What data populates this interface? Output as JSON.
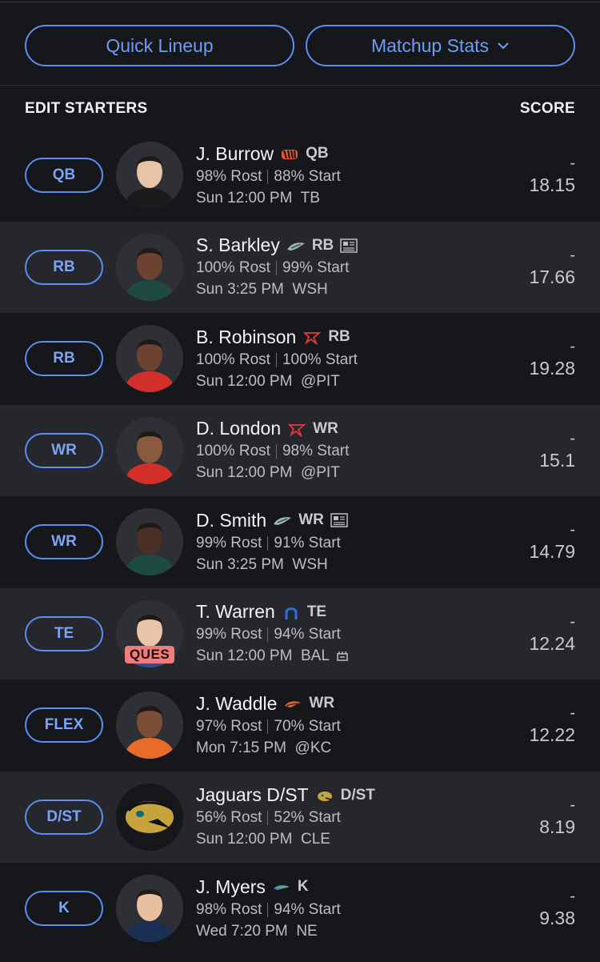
{
  "actions": {
    "quick_lineup": "Quick Lineup",
    "matchup_stats": "Matchup Stats"
  },
  "header": {
    "left": "EDIT STARTERS",
    "right": "SCORE"
  },
  "colors": {
    "accent": "#5a8ef0",
    "row_alt": "#26272c",
    "background": "#16171b",
    "ques_badge": "#f07c7c"
  },
  "players": [
    {
      "slot": "QB",
      "name": "J. Burrow",
      "team_icon": "bengals-icon",
      "pos": "QB",
      "rost": "98% Rost",
      "start": "88% Start",
      "game": "Sun 12:00 PM  TB",
      "dash": "-",
      "score": "18.15"
    },
    {
      "slot": "RB",
      "name": "S. Barkley",
      "team_icon": "eagles-icon",
      "pos": "RB",
      "news": true,
      "rost": "100% Rost",
      "start": "99% Start",
      "game": "Sun 3:25 PM  WSH",
      "dash": "-",
      "score": "17.66"
    },
    {
      "slot": "RB",
      "name": "B. Robinson",
      "team_icon": "falcons-icon",
      "pos": "RB",
      "rost": "100% Rost",
      "start": "100% Start",
      "game": "Sun 12:00 PM  @PIT",
      "dash": "-",
      "score": "19.28"
    },
    {
      "slot": "WR",
      "name": "D. London",
      "team_icon": "falcons-icon",
      "pos": "WR",
      "rost": "100% Rost",
      "start": "98% Start",
      "game": "Sun 12:00 PM  @PIT",
      "dash": "-",
      "score": "15.1"
    },
    {
      "slot": "WR",
      "name": "D. Smith",
      "team_icon": "eagles-icon",
      "pos": "WR",
      "news": true,
      "rost": "99% Rost",
      "start": "91% Start",
      "game": "Sun 3:25 PM  WSH",
      "dash": "-",
      "score": "14.79"
    },
    {
      "slot": "TE",
      "name": "T. Warren",
      "team_icon": "colts-icon",
      "pos": "TE",
      "status": "QUES",
      "rost": "99% Rost",
      "start": "94% Start",
      "game": "Sun 12:00 PM  BAL",
      "game_icon": "stadium-icon",
      "dash": "-",
      "score": "12.24"
    },
    {
      "slot": "FLEX",
      "name": "J. Waddle",
      "team_icon": "broncos-icon",
      "pos": "WR",
      "rost": "97% Rost",
      "start": "70% Start",
      "game": "Mon 7:15 PM  @KC",
      "dash": "-",
      "score": "12.22"
    },
    {
      "slot": "D/ST",
      "name": "Jaguars D/ST",
      "team_icon": "jaguars-icon",
      "pos": "D/ST",
      "rost": "56% Rost",
      "start": "52% Start",
      "game": "Sun 12:00 PM  CLE",
      "dash": "-",
      "score": "8.19"
    },
    {
      "slot": "K",
      "name": "J. Myers",
      "team_icon": "seahawks-icon",
      "pos": "K",
      "rost": "98% Rost",
      "start": "94% Start",
      "game": "Wed 7:20 PM  NE",
      "dash": "-",
      "score": "9.38"
    }
  ]
}
